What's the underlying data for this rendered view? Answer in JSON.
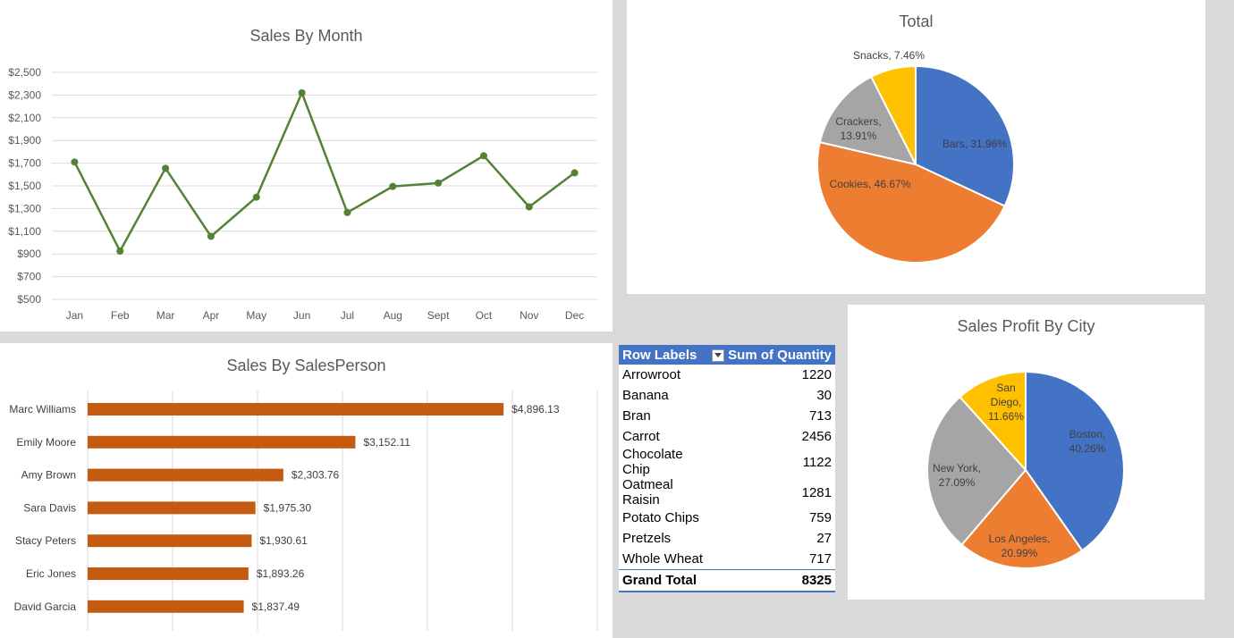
{
  "line_chart": {
    "chart_data": {
      "type": "line",
      "title": "Sales By Month",
      "categories": [
        "Jan",
        "Feb",
        "Mar",
        "Apr",
        "May",
        "Jun",
        "Jul",
        "Aug",
        "Sept",
        "Oct",
        "Nov",
        "Dec"
      ],
      "values": [
        1710,
        925,
        1655,
        1055,
        1400,
        2320,
        1265,
        1495,
        1525,
        1765,
        1315,
        1615
      ],
      "ylim": [
        500,
        2500
      ],
      "yticks": [
        "$500",
        "$700",
        "$900",
        "$1,100",
        "$1,300",
        "$1,500",
        "$1,700",
        "$1,900",
        "$2,100",
        "$2,300",
        "$2,500"
      ],
      "color": "#548235",
      "grid": true
    }
  },
  "total_pie": {
    "chart_data": {
      "type": "pie",
      "title": "Total",
      "slices": [
        {
          "label": "Bars, 31.96%",
          "value": 31.96,
          "color": "#4472c4"
        },
        {
          "label": "Cookies, 46.67%",
          "value": 46.67,
          "color": "#ed7d31"
        },
        {
          "label": "Crackers, 13.91%",
          "value": 13.91,
          "color": "#a5a5a5"
        },
        {
          "label": "Snacks, 7.46%",
          "value": 7.46,
          "color": "#ffc000"
        }
      ]
    }
  },
  "bar_chart": {
    "chart_data": {
      "type": "bar",
      "title": "Sales By SalesPerson",
      "categories": [
        "Marc Williams",
        "Emily Moore",
        "Amy Brown",
        "Sara Davis",
        "Stacy Peters",
        "Eric Jones",
        "David Garcia"
      ],
      "values": [
        4896.13,
        3152.11,
        2303.76,
        1975.3,
        1930.61,
        1893.26,
        1837.49
      ],
      "value_labels": [
        "$4,896.13",
        "$3,152.11",
        "$2,303.76",
        "$1,975.30",
        "$1,930.61",
        "$1,893.26",
        "$1,837.49"
      ],
      "xlim": [
        0,
        6000
      ],
      "color": "#c55a11",
      "grid": true
    }
  },
  "city_pie": {
    "chart_data": {
      "type": "pie",
      "title": "Sales Profit By City",
      "slices": [
        {
          "label": "Boston, 40.26%",
          "value": 40.26,
          "color": "#4472c4"
        },
        {
          "label": "Los Angeles, 20.99%",
          "value": 20.99,
          "color": "#ed7d31"
        },
        {
          "label": "New York, 27.09%",
          "value": 27.09,
          "color": "#a5a5a5"
        },
        {
          "label": "San Diego, 11.66%",
          "value": 11.66,
          "color": "#ffc000"
        }
      ]
    }
  },
  "pivot": {
    "header_labels": "Row Labels",
    "header_value": "Sum of Quantity",
    "rows": [
      {
        "label": "Arrowroot",
        "value": "1220"
      },
      {
        "label": "Banana",
        "value": "30"
      },
      {
        "label": "Bran",
        "value": "713"
      },
      {
        "label": "Carrot",
        "value": "2456"
      },
      {
        "label": "Chocolate Chip",
        "value": "1122"
      },
      {
        "label": "Oatmeal Raisin",
        "value": "1281"
      },
      {
        "label": "Potato Chips",
        "value": "759"
      },
      {
        "label": "Pretzels",
        "value": "27"
      },
      {
        "label": "Whole Wheat",
        "value": "717"
      }
    ],
    "total_label": "Grand Total",
    "total_value": "8325"
  }
}
